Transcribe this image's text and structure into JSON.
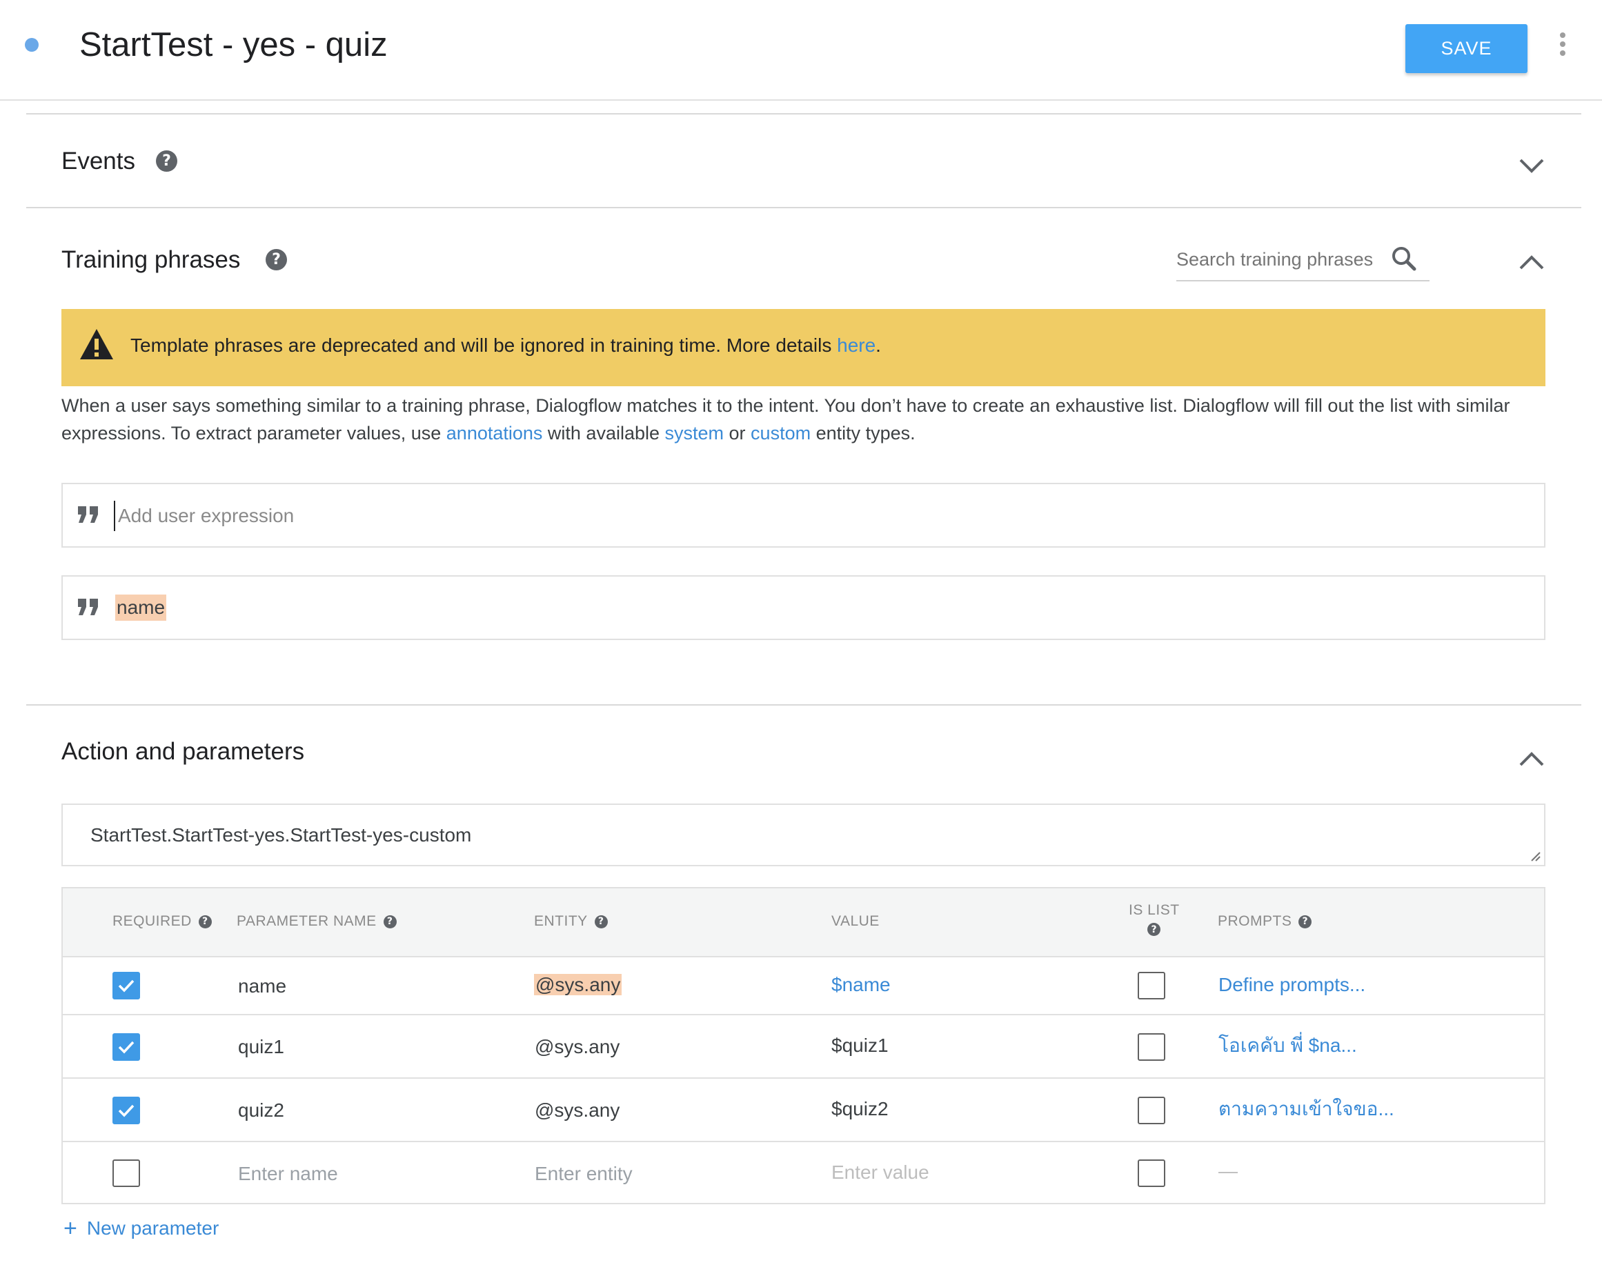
{
  "header": {
    "title": "StartTest - yes - quiz",
    "save_label": "SAVE"
  },
  "events": {
    "title": "Events"
  },
  "training": {
    "title": "Training phrases",
    "search_placeholder": "Search training phrases",
    "warning_text": "Template phrases are deprecated and will be ignored in training time. More details ",
    "warning_link": "here",
    "warning_end": ".",
    "desc_1": "When a user says something similar to a training phrase, Dialogflow matches it to the intent. You don’t have to create an exhaustive list. Dialogflow will fill out the list with similar expressions. To extract parameter values, use ",
    "desc_link_annotations": "annotations",
    "desc_2": " with available ",
    "desc_link_system": "system",
    "desc_3": " or ",
    "desc_link_custom": "custom",
    "desc_4": " entity types.",
    "add_placeholder": "Add user expression",
    "phrases": [
      "name"
    ]
  },
  "action": {
    "title": "Action and parameters",
    "action_name": "StartTest.StartTest-yes.StartTest-yes-custom",
    "columns": {
      "required": "REQUIRED",
      "parameter_name": "PARAMETER NAME",
      "entity": "ENTITY",
      "value": "VALUE",
      "is_list": "IS LIST",
      "prompts": "PROMPTS"
    },
    "params": [
      {
        "required": true,
        "name": "name",
        "entity": "@sys.any",
        "value": "$name",
        "is_list": false,
        "prompts": "Define prompts..."
      },
      {
        "required": true,
        "name": "quiz1",
        "entity": "@sys.any",
        "value": "$quiz1",
        "is_list": false,
        "prompts": "โอเคคับ พี่ $na..."
      },
      {
        "required": true,
        "name": "quiz2",
        "entity": "@sys.any",
        "value": "$quiz2",
        "is_list": false,
        "prompts": "ตามความเข้าใจขอ..."
      }
    ],
    "empty_row": {
      "required": false,
      "name_placeholder": "Enter name",
      "entity_placeholder": "Enter entity",
      "value_placeholder": "Enter value",
      "is_list": false,
      "prompts": "—"
    },
    "new_parameter_label": "New parameter"
  },
  "colors": {
    "accent": "#42a5f5",
    "link": "#3a8ad6",
    "warning_bg": "#f0cc65",
    "annotation_bg": "#f8cfb0",
    "status_dot": "#6aa8e8"
  },
  "icons": {
    "help": "help-circle-icon",
    "expand": "chevron-down-icon",
    "collapse": "chevron-up-icon",
    "search": "search-icon",
    "warning": "warning-icon",
    "quote": "quote-icon",
    "more": "more-vert-icon",
    "add": "plus-icon"
  }
}
